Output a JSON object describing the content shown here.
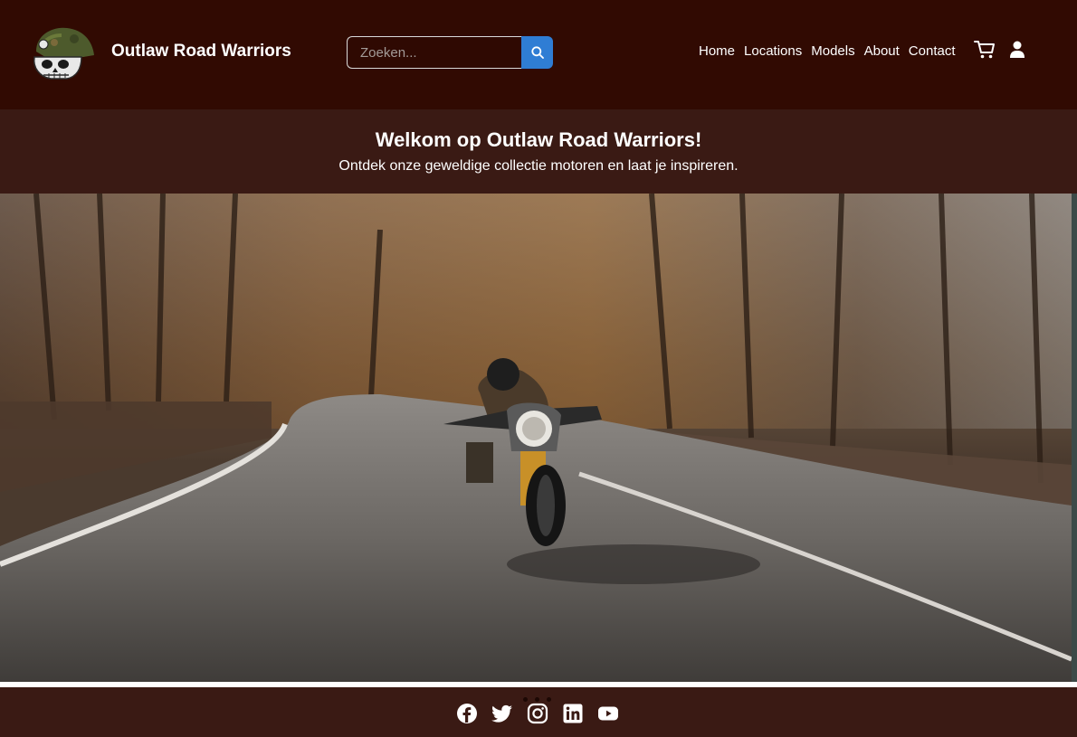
{
  "header": {
    "brand": "Outlaw Road Warriors",
    "logo_icon": "skull-helmet-logo",
    "search": {
      "placeholder": "Zoeken...",
      "value": "",
      "button_icon": "search-icon"
    },
    "nav": [
      {
        "label": "Home"
      },
      {
        "label": "Locations"
      },
      {
        "label": "Models"
      },
      {
        "label": "About"
      },
      {
        "label": "Contact"
      }
    ],
    "cart_icon": "cart-icon",
    "user_icon": "user-icon",
    "background_color": "#310a02"
  },
  "welcome": {
    "title": "Welkom op Outlaw Road Warriors!",
    "subtitle": "Ontdek onze geweldige collectie motoren en laat je inspireren.",
    "background_color": "#3a1a14"
  },
  "carousel": {
    "image": "motorcyclist-forest-road-photo",
    "slide_count": 3,
    "active_slide": 1
  },
  "footer": {
    "social": [
      {
        "icon": "facebook-icon"
      },
      {
        "icon": "twitter-icon"
      },
      {
        "icon": "instagram-icon"
      },
      {
        "icon": "linkedin-icon"
      },
      {
        "icon": "youtube-icon"
      }
    ],
    "background_color": "#3a1a14"
  },
  "colors": {
    "accent": "#2f7dd4",
    "text": "#ffffff"
  }
}
